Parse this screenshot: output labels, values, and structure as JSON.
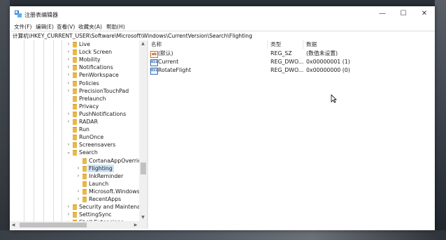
{
  "window": {
    "title": "注册表编辑器",
    "buttons": {
      "minimize": "—",
      "maximize": "☐",
      "close": "✕"
    }
  },
  "menu": [
    "文件(F)",
    "编辑(E)",
    "查看(V)",
    "收藏夹(A)",
    "帮助(H)"
  ],
  "address": "计算机\\HKEY_CURRENT_USER\\Software\\Microsoft\\Windows\\CurrentVersion\\Search\\Flighting",
  "tree": {
    "items": [
      {
        "label": "Live",
        "chevron": "›",
        "level": 0
      },
      {
        "label": "Lock Screen",
        "chevron": "›",
        "level": 0
      },
      {
        "label": "Mobility",
        "chevron": "›",
        "level": 0
      },
      {
        "label": "Notifications",
        "chevron": "›",
        "level": 0
      },
      {
        "label": "PenWorkspace",
        "chevron": "›",
        "level": 0
      },
      {
        "label": "Policies",
        "chevron": "›",
        "level": 0
      },
      {
        "label": "PrecisionTouchPad",
        "chevron": "›",
        "level": 0
      },
      {
        "label": "Prelaunch",
        "chevron": "",
        "level": 0
      },
      {
        "label": "Privacy",
        "chevron": "",
        "level": 0
      },
      {
        "label": "PushNotifications",
        "chevron": "›",
        "level": 0
      },
      {
        "label": "RADAR",
        "chevron": "›",
        "level": 0
      },
      {
        "label": "Run",
        "chevron": "",
        "level": 0
      },
      {
        "label": "RunOnce",
        "chevron": "",
        "level": 0
      },
      {
        "label": "Screensavers",
        "chevron": "›",
        "level": 0
      },
      {
        "label": "Search",
        "chevron": "⌄",
        "level": 0
      },
      {
        "label": "CortanaAppOverride",
        "chevron": "",
        "level": 1
      },
      {
        "label": "Flighting",
        "chevron": "›",
        "level": 1,
        "selected": true
      },
      {
        "label": "InkReminder",
        "chevron": "›",
        "level": 1
      },
      {
        "label": "Launch",
        "chevron": "",
        "level": 1
      },
      {
        "label": "Microsoft.Windows.Cor",
        "chevron": "›",
        "level": 1
      },
      {
        "label": "RecentApps",
        "chevron": "›",
        "level": 1
      },
      {
        "label": "Security and Maintenance",
        "chevron": "›",
        "level": 0
      },
      {
        "label": "SettingSync",
        "chevron": "›",
        "level": 0
      },
      {
        "label": "Shell Extensions",
        "chevron": "›",
        "level": 0
      }
    ]
  },
  "values": {
    "columns": {
      "name": "名称",
      "type": "类型",
      "data": "数据"
    },
    "rows": [
      {
        "icon": "string-value-icon",
        "icon_text": "ab",
        "name": "(默认)",
        "type": "REG_SZ",
        "data": "(数值未设置)"
      },
      {
        "icon": "binary-value-icon",
        "icon_text": "011",
        "name": "Current",
        "type": "REG_DWO...",
        "data": "0x00000001 (1)"
      },
      {
        "icon": "binary-value-icon",
        "icon_text": "011",
        "name": "RotateFlight",
        "type": "REG_DWO...",
        "data": "0x00000000 (0)"
      }
    ]
  },
  "colors": {
    "selection": "#cce4f7",
    "folder": "#e8b84a"
  }
}
